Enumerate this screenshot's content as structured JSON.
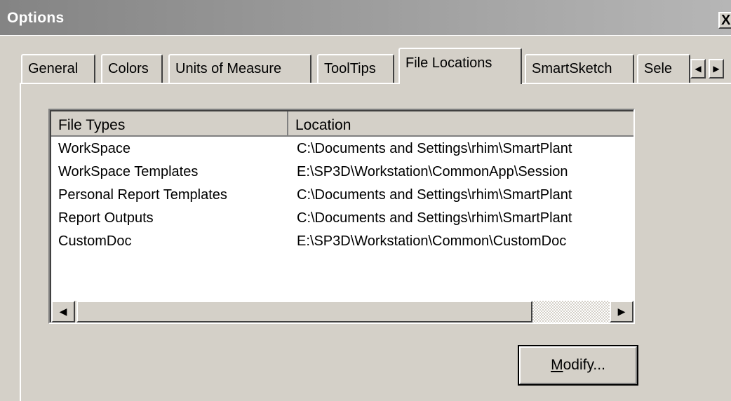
{
  "window": {
    "title": "Options",
    "close_label": "X"
  },
  "tabs": [
    {
      "label": "General",
      "active": false
    },
    {
      "label": "Colors",
      "active": false
    },
    {
      "label": "Units of Measure",
      "active": false
    },
    {
      "label": "ToolTips",
      "active": false
    },
    {
      "label": "File Locations",
      "active": true
    },
    {
      "label": "SmartSketch",
      "active": false
    },
    {
      "label": "Sele",
      "active": false
    }
  ],
  "tab_scroll": {
    "left_icon": "◀",
    "right_icon": "▶"
  },
  "file_list": {
    "columns": [
      "File Types",
      "Location"
    ],
    "rows": [
      {
        "type": "WorkSpace",
        "location": "C:\\Documents and Settings\\rhim\\SmartPlant"
      },
      {
        "type": "WorkSpace Templates",
        "location": "E:\\SP3D\\Workstation\\CommonApp\\Session"
      },
      {
        "type": "Personal Report Templates",
        "location": "C:\\Documents and Settings\\rhim\\SmartPlant"
      },
      {
        "type": "Report Outputs",
        "location": "C:\\Documents and Settings\\rhim\\SmartPlant"
      },
      {
        "type": "CustomDoc",
        "location": "E:\\SP3D\\Workstation\\Common\\CustomDoc"
      }
    ],
    "scroll_left_icon": "◀",
    "scroll_right_icon": "▶"
  },
  "buttons": {
    "modify_mnemonic": "M",
    "modify_rest": "odify..."
  }
}
